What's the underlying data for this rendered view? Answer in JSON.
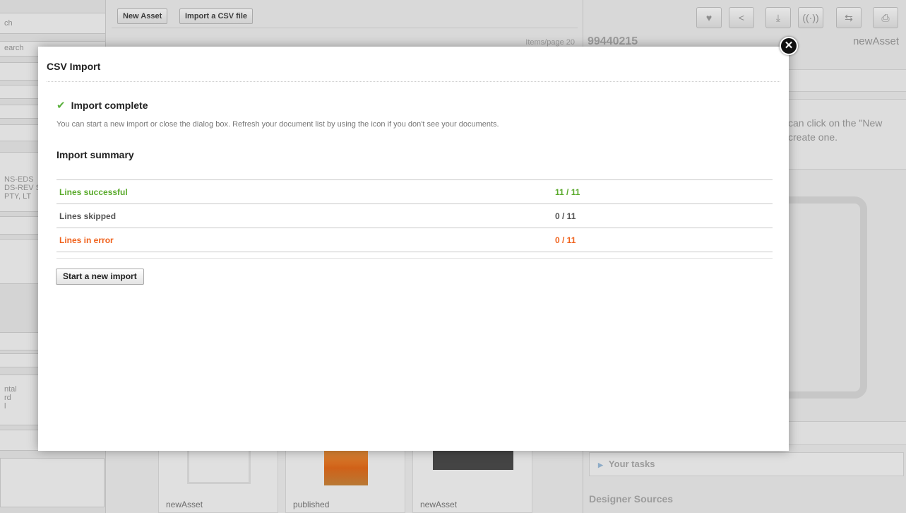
{
  "background": {
    "left_panel": {
      "search_label": "ch",
      "search_placeholder": "earch",
      "companies": [
        "NS-EDS",
        "DS-REV S",
        "PTY, LT"
      ],
      "misc": [
        "ntal",
        "rd",
        "l"
      ]
    },
    "toolbar": {
      "new_asset_label": "New Asset",
      "import_csv_label": "Import a CSV file",
      "paging_label": "Items/page",
      "paging_value": "20"
    },
    "thumbnails": [
      {
        "caption": "newAsset"
      },
      {
        "caption": "published"
      },
      {
        "caption": "newAsset"
      }
    ],
    "right_panel": {
      "asset_id": "99440215",
      "asset_name": "newAsset",
      "hint_text": "can click on the \"New create one.",
      "tasks_label": "Your tasks",
      "designer_sources_label": "Designer Sources",
      "action_icons": [
        "heart-icon",
        "share-icon",
        "download-icon",
        "broadcast-icon",
        "transfer-icon",
        "print-icon"
      ]
    }
  },
  "dialog": {
    "title": "CSV Import",
    "status": {
      "icon": "check-icon",
      "text": "Import complete"
    },
    "description": "You can start a new import or close the dialog box. Refresh your document list by using the icon if you don't see your documents.",
    "summary_title": "Import summary",
    "summary_rows": [
      {
        "label": "Lines successful",
        "value": "11 / 11",
        "color": "#5aaa2c"
      },
      {
        "label": "Lines skipped",
        "value": "0 / 11",
        "color": "#555555"
      },
      {
        "label": "Lines in error",
        "value": "0 / 11",
        "color": "#f0621c"
      }
    ],
    "new_import_button": "Start a new import",
    "close_icon": "close-icon"
  }
}
